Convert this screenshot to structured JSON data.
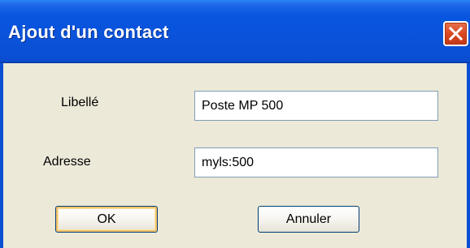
{
  "window": {
    "title": "Ajout d'un contact",
    "close_icon": "close-icon",
    "colors": {
      "titlebar": "#0a52d9",
      "close_button": "#d8451f",
      "body": "#ece9d8"
    }
  },
  "form": {
    "label_field": {
      "label": "Libellé",
      "value": "Poste MP 500"
    },
    "address_field": {
      "label": "Adresse",
      "value": "myls:500"
    }
  },
  "buttons": {
    "ok_label": "OK",
    "cancel_label": "Annuler"
  }
}
